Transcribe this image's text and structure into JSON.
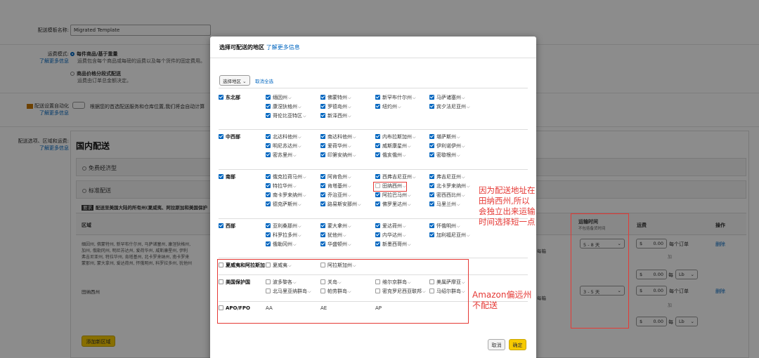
{
  "form": {
    "template_label": "配送模板名称:",
    "template_value": "Migrated Template",
    "fee_mode_label": "运费模式:",
    "learn_more": "了解更多信息",
    "fee_opt1_title": "每件商品/基于重量",
    "fee_opt1_desc": "运费包含每个商品或每磅的运费以及每个货件的固定费用。",
    "fee_opt2_title": "商品价格分段式配送",
    "fee_opt2_desc": "运费由订单总金额决定。",
    "auto_label": "配送设置自动化",
    "auto_desc": "根据您的首选配送服务和仓库位置,我们将会自动计算",
    "options_label": "配送选项、区域和运费:",
    "domestic_title": "国内配送",
    "free_econ": "免费经济型",
    "standard": "标准配送",
    "info_badge": "要求",
    "info_text": "配送至美国大陆的所有州(夏威夷、阿拉斯加和美国保护",
    "col_region": "区域",
    "col_time": "运输时间",
    "col_time_sub": "不包括备货时间",
    "col_fee": "运费",
    "col_action": "操作",
    "region_row1_lines": [
      "缅因州, 佛蒙特州, 新罕布什尔州, 马萨诸塞州, 康涅狄格州,",
      "加州, 俄勒冈州, 明尼苏达州, 爱荷华州, 威斯康星州, 伊利",
      "弗吉尼亚州, 特拉华州, 肯塔基州, 北卡罗来纳州, 南卡罗来",
      "蒙那州, 蒙大拿州, 爱达荷州, 怀俄明州, 科罗拉多州, 犹他州"
    ],
    "region_row2": "田纳西州",
    "row_mode_text": "每箱",
    "time1": "5 - 8 天",
    "time2": "3 - 5 天",
    "currency": "$",
    "fee_value": "0.00",
    "per_order": "每个订单",
    "plus": "加",
    "per": "每",
    "unit": "Lb",
    "delete": "删除",
    "add_region": "添加新区域"
  },
  "modal": {
    "title": "选择可配送的地区",
    "title_link": "了解更多信息",
    "select_region": "选择地区",
    "clear_all": "取消全选",
    "cancel": "取消",
    "confirm": "确定",
    "sections": [
      {
        "name": "东北部",
        "checked": true,
        "states": [
          [
            "缅因州",
            "佛蒙特州",
            "新罕布什尔州",
            "马萨诸塞州"
          ],
          [
            "康涅狄格州",
            "罗德岛州",
            "纽约州",
            "宾夕法尼亚州"
          ],
          [
            "哥伦比亚特区",
            "新泽西州"
          ]
        ]
      },
      {
        "name": "中西部",
        "checked": true,
        "states": [
          [
            "北达科他州",
            "南达科他州",
            "内布拉斯加州",
            "堪萨斯州"
          ],
          [
            "明尼苏达州",
            "爱荷华州",
            "威斯康星州",
            "伊利诺伊州"
          ],
          [
            "密苏里州",
            "印第安纳州",
            "俄亥俄州",
            "密歇根州"
          ]
        ]
      },
      {
        "name": "南部",
        "checked": true,
        "states": [
          [
            "俄克拉荷马州",
            "阿肯色州",
            "西弗吉尼亚州",
            "弗吉尼亚州"
          ],
          [
            "特拉华州",
            "肯塔基州",
            "田纳西州",
            "北卡罗来纳州"
          ],
          [
            "南卡罗来纳州",
            "乔治亚州",
            "阿拉巴马州",
            "密西西比州"
          ],
          [
            "德克萨斯州",
            "路易斯安那州",
            "佛罗里达州",
            "马里兰州"
          ]
        ]
      },
      {
        "name": "西部",
        "checked": true,
        "states": [
          [
            "亚利桑那州",
            "蒙大拿州",
            "爱达荷州",
            "怀俄明州"
          ],
          [
            "科罗拉多州",
            "犹他州",
            "内华达州",
            "加利福尼亚州"
          ],
          [
            "俄勒冈州",
            "华盛顿州",
            "新墨西哥州"
          ]
        ]
      },
      {
        "name": "夏威夷和阿拉斯加",
        "checked": false,
        "states": [
          [
            "夏威夷",
            "阿拉斯加州"
          ]
        ]
      },
      {
        "name": "美国保护国",
        "checked": false,
        "states": [
          [
            "波多黎各",
            "关岛",
            "维尔京群岛",
            "美属萨摩亚"
          ],
          [
            "北马里亚纳群岛",
            "帕劳群岛",
            "密克罗尼西亚联邦",
            "马绍尔群岛"
          ]
        ]
      },
      {
        "name": "APO/FPO",
        "checked": false,
        "states": [
          [
            "AA",
            "AE",
            "AP"
          ]
        ]
      }
    ]
  },
  "annotations": {
    "tennessee": "因为配送地址在田纳西州,所以会独立出来运输时间选择短一点",
    "tennessee_lines": [
      "因为配送地址在",
      "田纳西州,所以",
      "会独立出来运输",
      "时间选择短一点"
    ],
    "amazon_lines": [
      "Amazon偏远州",
      "不配送"
    ]
  },
  "colors": {
    "accent": "#0066c0",
    "confirm": "#f7ca00",
    "annotation": "#e53935"
  }
}
